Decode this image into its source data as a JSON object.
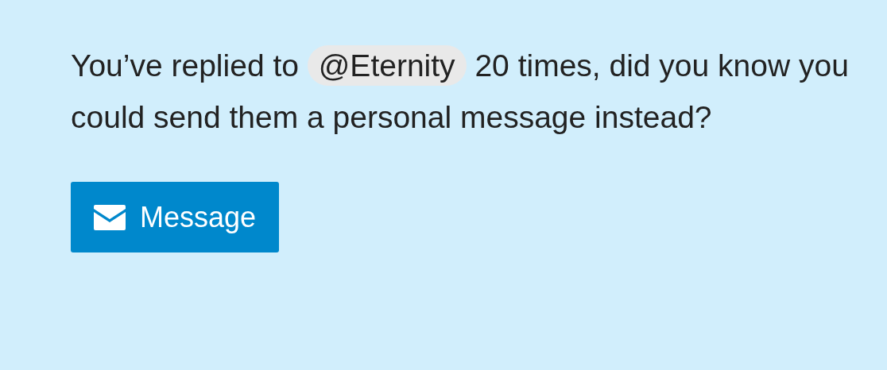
{
  "notice": {
    "text_before": "You’ve replied to",
    "mention": "@Eternity",
    "text_after": "20 times, did you know you could send them a personal message instead?"
  },
  "button": {
    "label": "Message"
  }
}
